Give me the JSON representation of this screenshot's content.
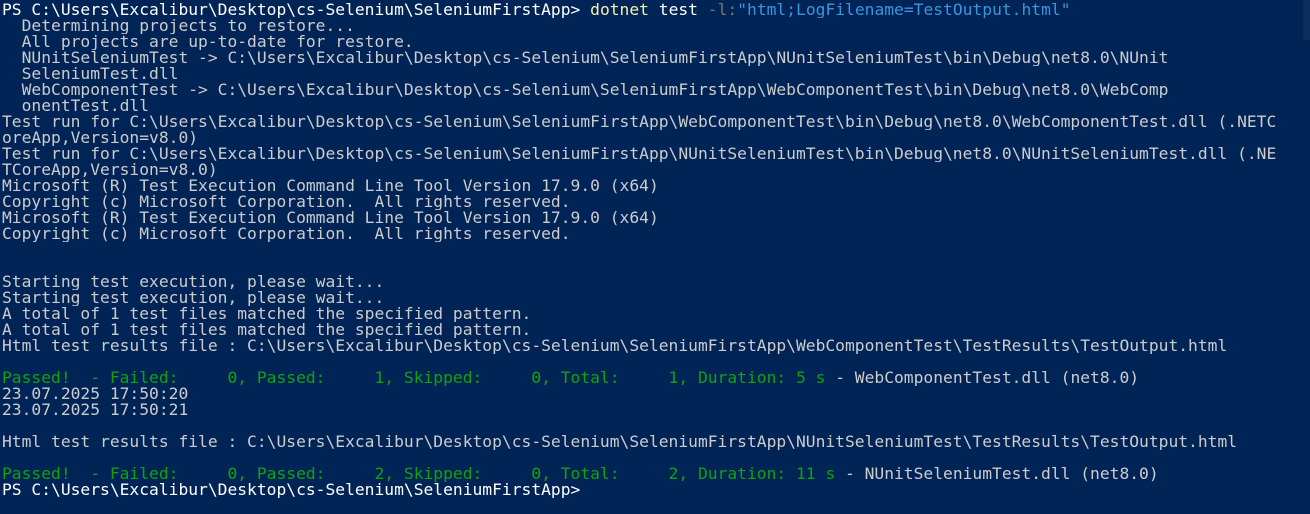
{
  "colors": {
    "background": "#012456",
    "text": "#cccccc",
    "command": "#f9f1a5",
    "parameter": "#767676",
    "string": "#3a96dd",
    "passed": "#13a10e"
  },
  "prompt": {
    "first": "PS C:\\Users\\Excalibur\\Desktop\\cs-Selenium\\SeleniumFirstApp> ",
    "command": "dotnet",
    "arg1": " test ",
    "param": "-l:",
    "string": "\"html;LogFilename=TestOutput.html\"",
    "last": "PS C:\\Users\\Excalibur\\Desktop\\cs-Selenium\\SeleniumFirstApp>"
  },
  "output": {
    "l01": "  Determining projects to restore...",
    "l02": "  All projects are up-to-date for restore.",
    "l03": "  NUnitSeleniumTest -> C:\\Users\\Excalibur\\Desktop\\cs-Selenium\\SeleniumFirstApp\\NUnitSeleniumTest\\bin\\Debug\\net8.0\\NUnit",
    "l04": "  SeleniumTest.dll",
    "l05": "  WebComponentTest -> C:\\Users\\Excalibur\\Desktop\\cs-Selenium\\SeleniumFirstApp\\WebComponentTest\\bin\\Debug\\net8.0\\WebComp",
    "l06": "  onentTest.dll",
    "l07": "Test run for C:\\Users\\Excalibur\\Desktop\\cs-Selenium\\SeleniumFirstApp\\WebComponentTest\\bin\\Debug\\net8.0\\WebComponentTest.dll (.NETC",
    "l08": "oreApp,Version=v8.0)",
    "l09": "Test run for C:\\Users\\Excalibur\\Desktop\\cs-Selenium\\SeleniumFirstApp\\NUnitSeleniumTest\\bin\\Debug\\net8.0\\NUnitSeleniumTest.dll (.NE",
    "l10": "TCoreApp,Version=v8.0)",
    "l11": "Microsoft (R) Test Execution Command Line Tool Version 17.9.0 (x64)",
    "l12": "Copyright (c) Microsoft Corporation.  All rights reserved.",
    "l13": "Microsoft (R) Test Execution Command Line Tool Version 17.9.0 (x64)",
    "l14": "Copyright (c) Microsoft Corporation.  All rights reserved.",
    "l15": "Starting test execution, please wait...",
    "l16": "Starting test execution, please wait...",
    "l17": "A total of 1 test files matched the specified pattern.",
    "l18": "A total of 1 test files matched the specified pattern.",
    "l19": "Html test results file : C:\\Users\\Excalibur\\Desktop\\cs-Selenium\\SeleniumFirstApp\\WebComponentTest\\TestResults\\TestOutput.html",
    "l20_pass": "Passed!  - Failed:     0, Passed:     1, Skipped:     0, Total:     1, Duration: 5 s",
    "l20_rest": " - WebComponentTest.dll (net8.0)",
    "l21": "23.07.2025 17:50:20",
    "l22": "23.07.2025 17:50:21",
    "l23": "Html test results file : C:\\Users\\Excalibur\\Desktop\\cs-Selenium\\SeleniumFirstApp\\NUnitSeleniumTest\\TestResults\\TestOutput.html",
    "l24_pass": "Passed!  - Failed:     0, Passed:     2, Skipped:     0, Total:     2, Duration: 11 s",
    "l24_rest": " - NUnitSeleniumTest.dll (net8.0)"
  }
}
